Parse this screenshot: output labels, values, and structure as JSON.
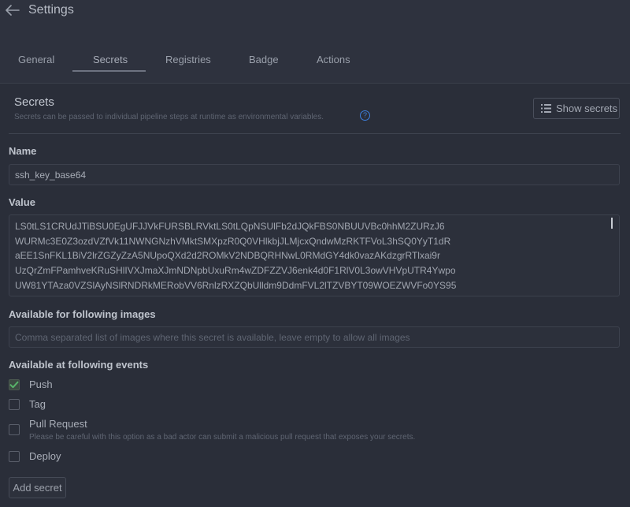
{
  "header": {
    "title": "Settings"
  },
  "tabs": [
    {
      "label": "General"
    },
    {
      "label": "Secrets"
    },
    {
      "label": "Registries"
    },
    {
      "label": "Badge"
    },
    {
      "label": "Actions"
    }
  ],
  "active_tab": "Secrets",
  "section": {
    "title": "Secrets",
    "subtitle": "Secrets can be passed to individual pipeline steps at runtime as environmental variables.",
    "help_icon": "question-circle-icon",
    "show_secrets_label": "Show secrets",
    "show_secrets_icon": "list-icon"
  },
  "form": {
    "name_label": "Name",
    "name_value": "ssh_key_base64",
    "value_label": "Value",
    "value_lines": [
      "LS0tLS1CRUdJTiBSU0EgUFJJVkFURSBLRVktLS0tLQpNSUlFb2dJQkFBS0NBUUVBc0hhM2ZURzJ6",
      "WURMc3E0Z3ozdVZfVk11NWNGNzhVMktSMXpzR0Q0VHlkbjJLMjcxQndwMzRKTFVoL3hSQ0YyT1dR",
      "aEE1SnFKL1BiV2lrZGZyZzA5NUpoQXd2d2ROMkV2NDBQRHNwL0RMdGY4dk0vazAKdzgrRTlxai9r",
      "UzQrZmFPamhveKRuSHlIVXJmaXJmNDNpbUxuRm4wZDFZZVJ6enk4d0F1RlV0L3owVHVpUTR4Ywpo",
      "UW81YTAza0VZSlAyNSlRNDRkMERobVV6RnlzRXZQbUlldm9DdmFVL2lTZVBYT09WOEZWVFo0YS95"
    ],
    "images_label": "Available for following images",
    "images_placeholder": "Comma separated list of images where this secret is available, leave empty to allow all images",
    "events_label": "Available at following events",
    "events": [
      {
        "label": "Push",
        "checked": true,
        "note": ""
      },
      {
        "label": "Tag",
        "checked": false,
        "note": ""
      },
      {
        "label": "Pull Request",
        "checked": false,
        "note": "Please be careful with this option as a bad actor can submit a malicious pull request that exposes your secrets."
      },
      {
        "label": "Deploy",
        "checked": false,
        "note": ""
      }
    ],
    "add_label": "Add secret"
  },
  "colors": {
    "background": "#2a2e39",
    "check": "#58b36a",
    "help": "#3d7fdc"
  }
}
